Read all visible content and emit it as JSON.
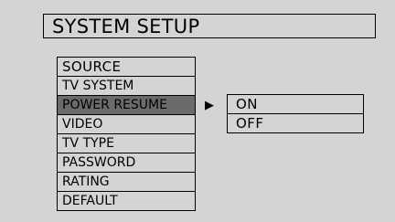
{
  "title": "SYSTEM SETUP",
  "menu": {
    "items": [
      {
        "label": "SOURCE"
      },
      {
        "label": "TV SYSTEM"
      },
      {
        "label": "POWER RESUME",
        "selected": true
      },
      {
        "label": "VIDEO"
      },
      {
        "label": "TV TYPE"
      },
      {
        "label": "PASSWORD"
      },
      {
        "label": "RATING"
      },
      {
        "label": "DEFAULT"
      }
    ]
  },
  "arrow_icon": "right-triangle-icon",
  "submenu": {
    "options": [
      {
        "label": "ON"
      },
      {
        "label": "OFF"
      }
    ]
  },
  "colors": {
    "background": "#d4d4d4",
    "highlight": "#6b6b6b",
    "border": "#000000"
  }
}
